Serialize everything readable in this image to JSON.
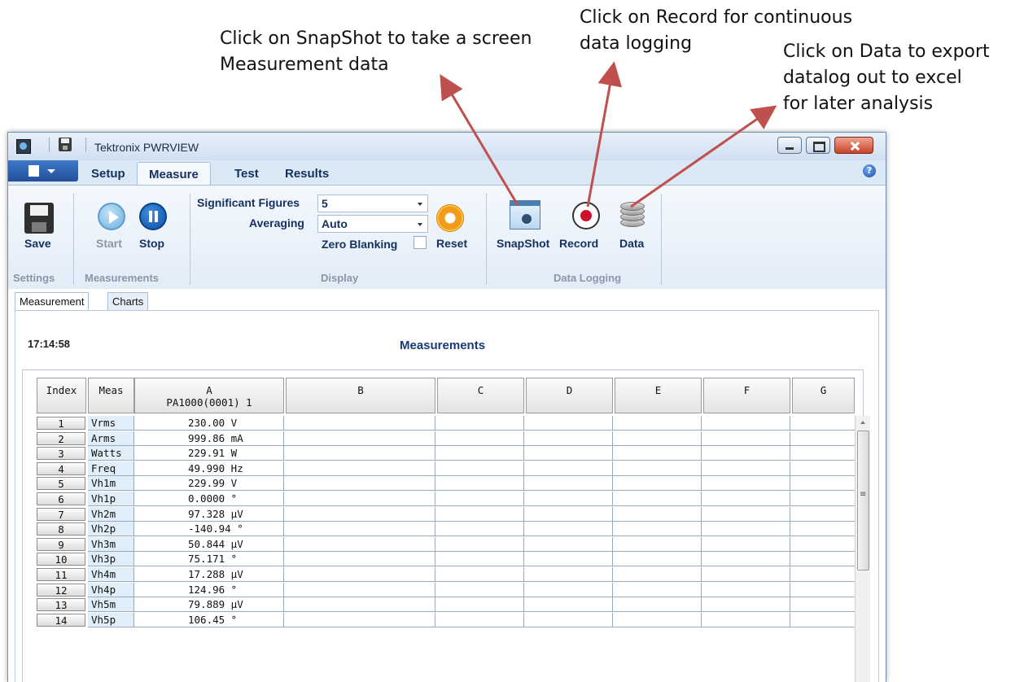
{
  "callouts": {
    "snapshot": "Click on SnapShot to take a screen\nMeasurement data",
    "record": "Click on Record for continuous\n data logging",
    "data": "Click on Data to export\ndatalog out to excel\nfor later analysis"
  },
  "window": {
    "title": "Tektronix PWRVIEW"
  },
  "tabs": [
    {
      "label": "Setup"
    },
    {
      "label": "Measure"
    },
    {
      "label": "Test"
    },
    {
      "label": "Results"
    }
  ],
  "ribbon": {
    "save": "Save",
    "start": "Start",
    "stop": "Stop",
    "sigfig_label": "Significant Figures",
    "sigfig_value": "5",
    "averaging_label": "Averaging",
    "averaging_value": "Auto",
    "zero_blanking": "Zero Blanking",
    "reset": "Reset",
    "snapshot": "SnapShot",
    "record": "Record",
    "data": "Data",
    "groups": {
      "settings": "Settings",
      "measurements": "Measurements",
      "display": "Display",
      "datalogging": "Data Logging"
    }
  },
  "subtabs": [
    {
      "label": "Measurement"
    },
    {
      "label": "Charts"
    }
  ],
  "time": "17:14:58",
  "measurements_title": "Measurements",
  "table": {
    "headers": {
      "index": "Index",
      "meas": "Meas",
      "a_line1": "A",
      "a_line2": "PA1000(0001) 1",
      "b": "B",
      "c": "C",
      "d": "D",
      "e": "E",
      "f": "F",
      "g": "G"
    },
    "rows": [
      {
        "index": "1",
        "meas": "Vrms",
        "value": "230.00 V"
      },
      {
        "index": "2",
        "meas": "Arms",
        "value": "999.86 mA"
      },
      {
        "index": "3",
        "meas": "Watts",
        "value": "229.91 W"
      },
      {
        "index": "4",
        "meas": "Freq",
        "value": "49.990 Hz"
      },
      {
        "index": "5",
        "meas": "Vh1m",
        "value": "229.99 V"
      },
      {
        "index": "6",
        "meas": "Vh1p",
        "value": "0.0000 °"
      },
      {
        "index": "7",
        "meas": "Vh2m",
        "value": "97.328 µV"
      },
      {
        "index": "8",
        "meas": "Vh2p",
        "value": "-140.94 °"
      },
      {
        "index": "9",
        "meas": "Vh3m",
        "value": "50.844 µV"
      },
      {
        "index": "10",
        "meas": "Vh3p",
        "value": "75.171 °"
      },
      {
        "index": "11",
        "meas": "Vh4m",
        "value": "17.288 µV"
      },
      {
        "index": "12",
        "meas": "Vh4p",
        "value": "124.96 °"
      },
      {
        "index": "13",
        "meas": "Vh5m",
        "value": "79.889 µV"
      },
      {
        "index": "14",
        "meas": "Vh5p",
        "value": "106.45 °"
      }
    ]
  },
  "colors": {
    "arrow": "#c0504d",
    "ribbon_text": "#15315f",
    "title_blue": "#1b3a78"
  },
  "icons": {
    "save": "floppy-disk-icon",
    "start": "play-icon",
    "stop": "pause-icon",
    "reset": "reset-icon",
    "snapshot": "camera-icon",
    "record": "record-icon",
    "data": "database-icon",
    "help": "help-icon"
  }
}
